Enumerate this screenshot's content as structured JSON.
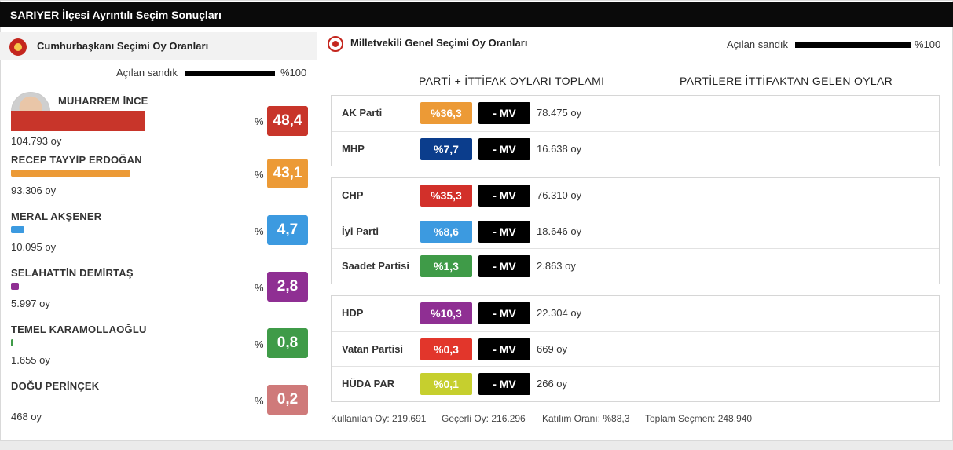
{
  "header": {
    "title": "SARIYER İlçesi Ayrıntılı Seçim Sonuçları"
  },
  "president": {
    "title": "Cumhurbaşkanı Seçimi Oy Oranları",
    "opened_label": "Açılan sandık",
    "opened_pct": "%100",
    "opened_fraction": 1.0,
    "pct_sign": "%",
    "candidates": [
      {
        "name": "MUHARREM İNCE",
        "votes": "104.793 oy",
        "pct": "48,4",
        "share": 48.4,
        "color": "#c8352a"
      },
      {
        "name": "RECEP TAYYİP ERDOĞAN",
        "votes": "93.306 oy",
        "pct": "43,1",
        "share": 43.1,
        "color": "#ec9a36"
      },
      {
        "name": "MERAL AKŞENER",
        "votes": "10.095 oy",
        "pct": "4,7",
        "share": 4.7,
        "color": "#3c9ae0"
      },
      {
        "name": "SELAHATTİN DEMİRTAŞ",
        "votes": "5.997 oy",
        "pct": "2,8",
        "share": 2.8,
        "color": "#8f2f93"
      },
      {
        "name": "TEMEL KARAMOLLAOĞLU",
        "votes": "1.655 oy",
        "pct": "0,8",
        "share": 0.8,
        "color": "#3f9b48"
      },
      {
        "name": "DOĞU PERİNÇEK",
        "votes": "468 oy",
        "pct": "0,2",
        "share": 0.2,
        "color": "#cf7a7a"
      }
    ]
  },
  "parliament": {
    "title": "Milletvekili Genel Seçimi Oy Oranları",
    "opened_label": "Açılan sandık",
    "opened_pct": "%100",
    "opened_fraction": 1.0,
    "col_left": "PARTİ + İTTİFAK OYLARI TOPLAMI",
    "col_right": "PARTİLERE İTTİFAKTAN GELEN OYLAR",
    "mv_label": "- MV",
    "groups": [
      [
        {
          "name": "AK Parti",
          "pct": "%36,3",
          "votes": "78.475 oy",
          "color": "#ec9a36"
        },
        {
          "name": "MHP",
          "pct": "%7,7",
          "votes": "16.638 oy",
          "color": "#0b3d8c"
        }
      ],
      [
        {
          "name": "CHP",
          "pct": "%35,3",
          "votes": "76.310 oy",
          "color": "#d2302a"
        },
        {
          "name": "İyi Parti",
          "pct": "%8,6",
          "votes": "18.646 oy",
          "color": "#3c9ae0"
        },
        {
          "name": "Saadet Partisi",
          "pct": "%1,3",
          "votes": "2.863 oy",
          "color": "#3f9b48"
        }
      ],
      [
        {
          "name": "HDP",
          "pct": "%10,3",
          "votes": "22.304 oy",
          "color": "#8f2f93"
        },
        {
          "name": "Vatan Partisi",
          "pct": "%0,3",
          "votes": "669 oy",
          "color": "#e2362b"
        },
        {
          "name": "HÜDA PAR",
          "pct": "%0,1",
          "votes": "266 oy",
          "color": "#c6cf2e"
        }
      ]
    ],
    "footer": {
      "used": "Kullanılan Oy: 219.691",
      "valid": "Geçerli Oy: 216.296",
      "turnout": "Katılım Oranı: %88,3",
      "voters": "Toplam Seçmen: 248.940"
    }
  }
}
